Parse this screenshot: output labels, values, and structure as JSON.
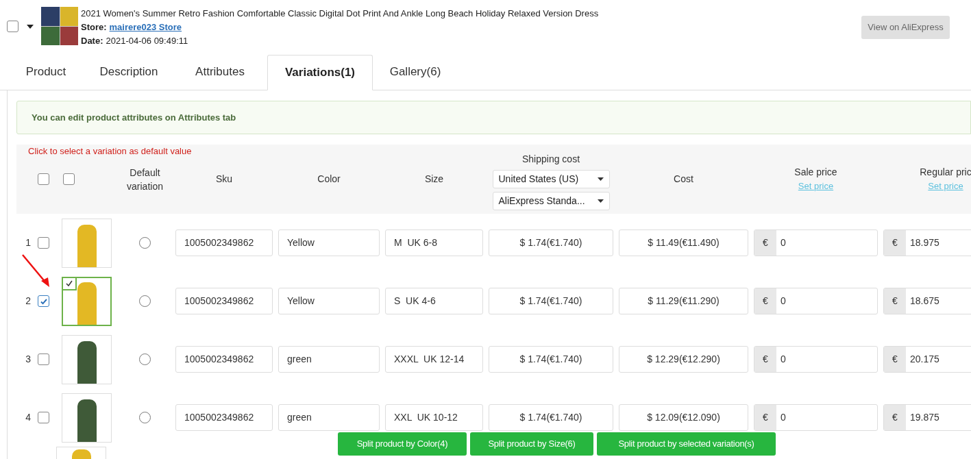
{
  "product": {
    "checked": false,
    "title": "2021 Women's Summer Retro Fashion Comfortable Classic Digital Dot Print And Ankle Long Beach Holiday Relaxed Version Dress",
    "store_label": "Store:",
    "store": "mairere023 Store",
    "date_label": "Date:",
    "date": "2021-04-06 09:49:11",
    "view_button": "View on AliExpress"
  },
  "tabs": [
    {
      "label": "Product",
      "selected": false
    },
    {
      "label": "Description",
      "selected": false
    },
    {
      "label": "Attributes",
      "selected": false
    },
    {
      "label": "Variations(1)",
      "selected": true
    },
    {
      "label": "Gallery(6)",
      "selected": false
    }
  ],
  "notice": "You can edit product attributes on Attributes tab",
  "hint": "Click to select a variation as default value",
  "table": {
    "select_all_checked": false,
    "select_all_images_checked": false,
    "columns": {
      "default": "Default variation",
      "sku": "Sku",
      "color_heading": "Color",
      "size": "Size",
      "shipping": "Shipping cost",
      "cost": "Cost",
      "sale": "Sale price",
      "regular": "Regular pric"
    },
    "shipping_country": "United States (US)",
    "shipping_method": "AliExpress Standa...",
    "set_price": "Set price",
    "set_price_regular": "Set price",
    "rows": [
      {
        "index": "1",
        "checked": false,
        "annotated": false,
        "image_selected": false,
        "color": "#e3b824",
        "default": false,
        "sku": "1005002349862",
        "color_value": "Yellow",
        "size": "M  UK 6-8",
        "shipping": "$ 1.74(€1.740)",
        "cost": "$ 11.49(€11.490)",
        "currency": "€",
        "sale": "0",
        "regular_currency": "€",
        "regular": "18.975"
      },
      {
        "index": "2",
        "checked": true,
        "annotated": true,
        "image_selected": true,
        "color": "#e3b824",
        "default": false,
        "sku": "1005002349862",
        "color_value": "Yellow",
        "size": "S  UK 4-6",
        "shipping": "$ 1.74(€1.740)",
        "cost": "$ 11.29(€11.290)",
        "currency": "€",
        "sale": "0",
        "regular_currency": "€",
        "regular": "18.675"
      },
      {
        "index": "3",
        "checked": false,
        "annotated": false,
        "image_selected": false,
        "color": "#3f5a38",
        "default": false,
        "sku": "1005002349862",
        "color_value": "green",
        "size": "XXXL  UK 12-14",
        "shipping": "$ 1.74(€1.740)",
        "cost": "$ 12.29(€12.290)",
        "currency": "€",
        "sale": "0",
        "regular_currency": "€",
        "regular": "20.175"
      },
      {
        "index": "4",
        "checked": false,
        "annotated": false,
        "image_selected": false,
        "color": "#3f5a38",
        "default": false,
        "sku": "1005002349862",
        "color_value": "green",
        "size": "XXL  UK 10-12",
        "shipping": "$ 1.74(€1.740)",
        "cost": "$ 12.09(€12.090)",
        "currency": "€",
        "sale": "0",
        "regular_currency": "€",
        "regular": "19.875"
      }
    ],
    "more_rows_below": true
  },
  "split_buttons": [
    "Split product by Color(4)",
    "Split product by Size(6)",
    "Split product by selected variation(s)"
  ]
}
